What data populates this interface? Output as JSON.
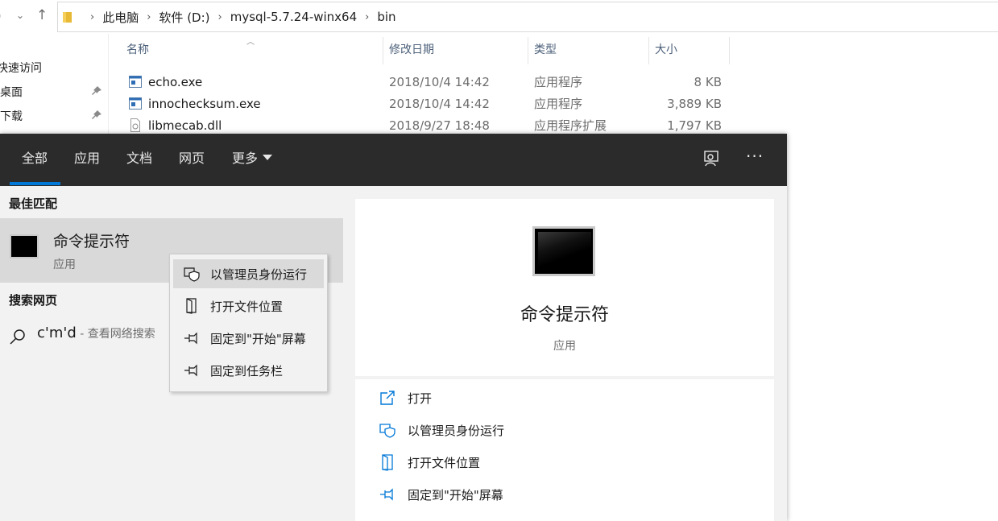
{
  "explorer": {
    "breadcrumbs": [
      "此电脑",
      "软件 (D:)",
      "mysql-5.7.24-winx64",
      "bin"
    ],
    "nav_items": [
      "快速访问",
      "桌面",
      "下载"
    ],
    "columns": {
      "name": "名称",
      "date": "修改日期",
      "type": "类型",
      "size": "大小"
    },
    "files": [
      {
        "name": "echo.exe",
        "date": "2018/10/4 14:42",
        "type": "应用程序",
        "size": "8 KB"
      },
      {
        "name": "innochecksum.exe",
        "date": "2018/10/4 14:42",
        "type": "应用程序",
        "size": "3,889 KB"
      },
      {
        "name": "libmecab.dll",
        "date": "2018/9/27 18:48",
        "type": "应用程序扩展",
        "size": "1,797 KB"
      }
    ]
  },
  "search": {
    "tabs": {
      "all": "全部",
      "apps": "应用",
      "docs": "文档",
      "web": "网页",
      "more": "更多"
    },
    "best_match_title": "最佳匹配",
    "best_match": {
      "name": "命令提示符",
      "kind": "应用"
    },
    "web_section_title": "搜索网页",
    "web_query": "c'm'd",
    "web_hint": " - 查看网络搜索",
    "detail": {
      "name": "命令提示符",
      "kind": "应用"
    },
    "actions": [
      "打开",
      "以管理员身份运行",
      "打开文件位置",
      "固定到\"开始\"屏幕"
    ]
  },
  "context_menu": {
    "items": [
      "以管理员身份运行",
      "打开文件位置",
      "固定到\"开始\"屏幕",
      "固定到任务栏"
    ],
    "highlighted_index": 0
  },
  "colors": {
    "accent": "#0078d7",
    "tabbar": "#2b2b2b",
    "panel_bg": "#f2f2f2"
  }
}
